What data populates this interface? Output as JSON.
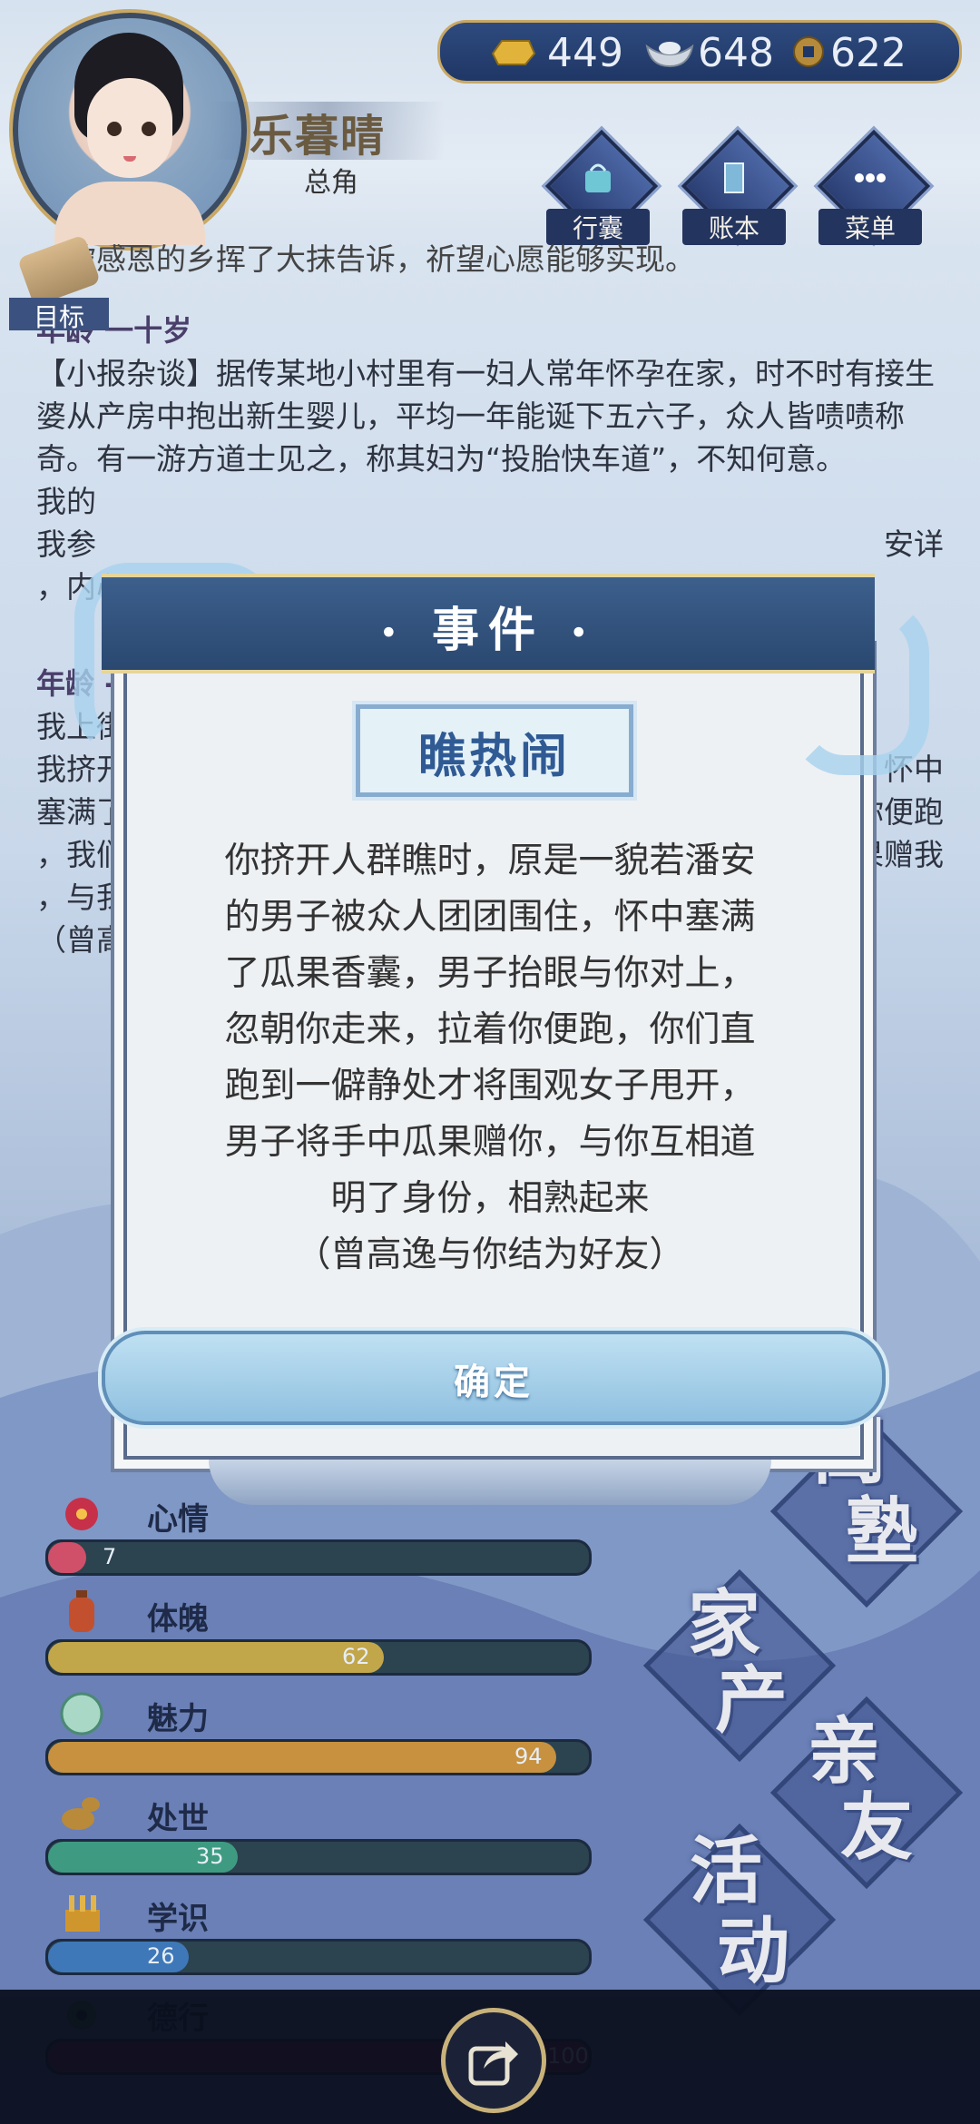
{
  "player": {
    "name": "乐暮晴",
    "role": "总角"
  },
  "currency": {
    "gold": {
      "icon": "gold-ingot-icon",
      "value": "449"
    },
    "silver": {
      "icon": "silver-ingot-icon",
      "value": "648"
    },
    "coin": {
      "icon": "copper-coin-icon",
      "value": "622"
    }
  },
  "menu": {
    "bag": {
      "label": "行囊",
      "icon": "bag-icon"
    },
    "ledger": {
      "label": "账本",
      "icon": "book-icon"
    },
    "more": {
      "label": "菜单",
      "icon": "more-dots-icon"
    }
  },
  "goal": {
    "label": "目标",
    "icon": "scroll-icon"
  },
  "log": {
    "partial_line": "，被感恩的乡挥了大抹告诉，祈望心愿能够实现。",
    "age_10": "年龄 一十岁",
    "entry_10": "【小报杂谈】据传某地小村里有一妇人常年怀孕在家，时不时有接生婆从产房中抱出新生婴儿，平均一年能诞下五六子，众人皆啧啧称奇。有一游方道士见之，称其妇为“投胎快车道”，不知何意。",
    "line_2": "我的",
    "line_3_left": "我参",
    "line_3_right": "安详",
    "line_4": "，内心",
    "age_11": "年龄 -",
    "entry_11_a": "我上街",
    "entry_11_b": "我挤开",
    "entry_11_b_right": "，怀中",
    "entry_11_c": "塞满了",
    "entry_11_c_right": "你便跑",
    "entry_11_d": "，我们",
    "entry_11_d_right": "果赠我",
    "entry_11_e": "，与我",
    "entry_11_f": "（曾高"
  },
  "stats": [
    {
      "name": "心情",
      "icon": "flower-icon",
      "value": 7,
      "max": 100,
      "color": "#d0506a"
    },
    {
      "name": "体魄",
      "icon": "lantern-icon",
      "value": 62,
      "max": 100,
      "color": "#c2a64a"
    },
    {
      "name": "魅力",
      "icon": "jade-icon",
      "value": 94,
      "max": 100,
      "color": "#c7913f"
    },
    {
      "name": "处世",
      "icon": "gourd-icon",
      "value": 35,
      "max": 100,
      "color": "#3e9b82"
    },
    {
      "name": "学识",
      "icon": "books-icon",
      "value": 26,
      "max": 100,
      "color": "#3f78b8"
    },
    {
      "name": "德行",
      "icon": "pendant-icon",
      "value": 100,
      "max": 100,
      "color": "#7a2a5a"
    }
  ],
  "stat_partial_value": "00",
  "nav": {
    "school": {
      "line1": "闺",
      "line2": "塾"
    },
    "property": {
      "line1": "家",
      "line2": "产"
    },
    "relatives": {
      "line1": "亲",
      "line2": "友"
    },
    "activity": {
      "line1": "活",
      "line2": "动"
    }
  },
  "modal": {
    "title": "事件",
    "title_left_dot": "•",
    "title_right_dot": "•",
    "event_name": "瞧热闹",
    "body_lines": [
      "你挤开人群瞧时，原是一貌若潘安",
      "的男子被众人团团围住，怀中塞满",
      "了瓜果香囊，男子抬眼与你对上，",
      "忽朝你走来，拉着你便跑，你们直",
      "跑到一僻静处才将围观女子甩开，",
      "男子将手中瓜果赠你，与你互相道",
      "明了身份，相熟起来",
      "（曾高逸与你结为好友）"
    ],
    "confirm_label": "确定"
  },
  "share": {
    "icon": "share-icon"
  }
}
